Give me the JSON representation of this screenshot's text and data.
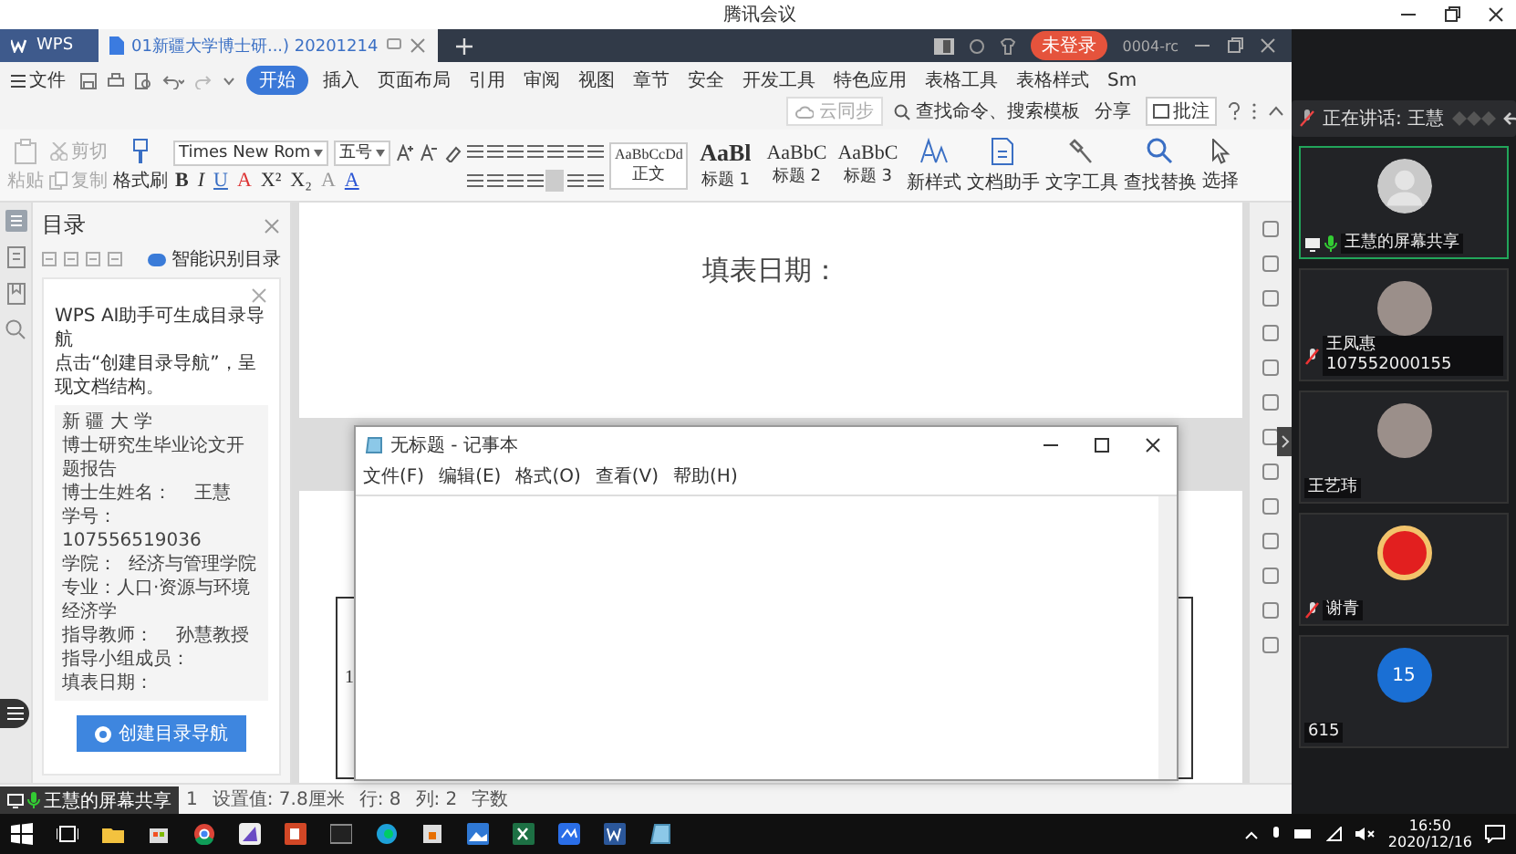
{
  "window": {
    "title": "腾讯会议"
  },
  "wps": {
    "tabs": [
      {
        "label": "WPS",
        "kind": "home",
        "selected": false
      },
      {
        "label": "01新疆大学博士研...) 20201214",
        "kind": "doc",
        "selected": true
      }
    ],
    "account": {
      "badge": "未登录",
      "id": "0004-rc"
    },
    "menu": [
      {
        "label": "文件",
        "kind": "file",
        "selected": false
      },
      {
        "label": "开始",
        "kind": "tab",
        "selected": true
      },
      {
        "label": "插入",
        "kind": "tab",
        "selected": false
      },
      {
        "label": "页面布局",
        "kind": "tab",
        "selected": false
      },
      {
        "label": "引用",
        "kind": "tab",
        "selected": false
      },
      {
        "label": "审阅",
        "kind": "tab",
        "selected": false
      },
      {
        "label": "视图",
        "kind": "tab",
        "selected": false
      },
      {
        "label": "章节",
        "kind": "tab",
        "selected": false
      },
      {
        "label": "安全",
        "kind": "tab",
        "selected": false
      },
      {
        "label": "开发工具",
        "kind": "tab",
        "selected": false
      },
      {
        "label": "特色应用",
        "kind": "tab",
        "selected": false
      },
      {
        "label": "表格工具",
        "kind": "tab",
        "selected": false
      },
      {
        "label": "表格样式",
        "kind": "tab",
        "selected": false
      },
      {
        "label": "Sm",
        "kind": "tab",
        "selected": false
      }
    ],
    "menu_tools": {
      "sync": "云同步",
      "search": "查找命令、搜索模板",
      "share": "分享",
      "comment": "批注"
    },
    "ribbon": {
      "clipboard": [
        {
          "label": "粘贴",
          "kind": "paste",
          "disabled": true
        },
        {
          "label": "剪切",
          "kind": "cut",
          "disabled": true
        },
        {
          "label": "复制",
          "kind": "copy",
          "disabled": true
        },
        {
          "label": "格式刷",
          "kind": "painter",
          "disabled": false
        }
      ],
      "font": "Times New Rom",
      "size": "五号",
      "format_letters": [
        "B",
        "I",
        "U",
        "A",
        "X²",
        "X₂",
        "A",
        "A"
      ],
      "styles": [
        {
          "preview": "AaBbCcDd",
          "label": "正文",
          "kind": "body",
          "selected": true
        },
        {
          "preview": "AaBl",
          "label": "标题 1",
          "kind": "h1",
          "selected": false
        },
        {
          "preview": "AaBbC",
          "label": "标题 2",
          "kind": "h2",
          "selected": false
        },
        {
          "preview": "AaBbC",
          "label": "标题 3",
          "kind": "h3",
          "selected": false
        }
      ],
      "tools": [
        {
          "label": "新样式",
          "kind": "style"
        },
        {
          "label": "文档助手",
          "kind": "assistant"
        },
        {
          "label": "文字工具",
          "kind": "wrench"
        },
        {
          "label": "查找替换",
          "kind": "find"
        },
        {
          "label": "选择",
          "kind": "select"
        }
      ]
    },
    "nav": {
      "title": "目录",
      "smart_toggle": {
        "label": "智能识别目录",
        "on": true
      },
      "intro": [
        "WPS AI助手可生成目录导航",
        "点击“创建目录导航”，呈现文档结构。"
      ],
      "preview": [
        "新 疆 大 学",
        "博士研究生毕业论文开题报告",
        "博士生姓名：    王慧",
        "学号：   107556519036",
        "学院：  经济与管理学院",
        "专业：人口·资源与环境经济学",
        "指导教师：    孙慧教授",
        "指导小组成员：",
        "填表日期："
      ],
      "button": "创建目录导航"
    },
    "document": {
      "heading": "填表日期：",
      "cell_text": "1"
    },
    "status": [
      "1",
      "设置值: 7.8厘米",
      "行: 8",
      "列: 2",
      "字数"
    ]
  },
  "notepad": {
    "title": "无标题 - 记事本",
    "menu": [
      "文件(F)",
      "编辑(E)",
      "格式(O)",
      "查看(V)",
      "帮助(H)"
    ]
  },
  "meeting": {
    "speaking": "正在讲话: 王慧",
    "share_label": "王慧的屏幕共享",
    "tiles": [
      {
        "name": "王慧的屏幕共享",
        "kind": "silhouette",
        "mic_on": true,
        "muted": false,
        "sharing": true,
        "speaking": true
      },
      {
        "name": "王凤惠 107552000155",
        "kind": "photo",
        "mic_on": false,
        "muted": true,
        "sharing": false,
        "speaking": false
      },
      {
        "name": "王艺玮",
        "kind": "photo",
        "mic_on": false,
        "muted": false,
        "sharing": false,
        "speaking": false
      },
      {
        "name": "谢青",
        "kind": "cartoon",
        "mic_on": false,
        "muted": true,
        "sharing": false,
        "speaking": false
      },
      {
        "name": "615",
        "kind": "initials",
        "avatar_text": "15",
        "mic_on": false,
        "muted": false,
        "sharing": false,
        "speaking": false
      }
    ]
  },
  "taskbar": {
    "time": "16:50",
    "date": "2020/12/16"
  }
}
